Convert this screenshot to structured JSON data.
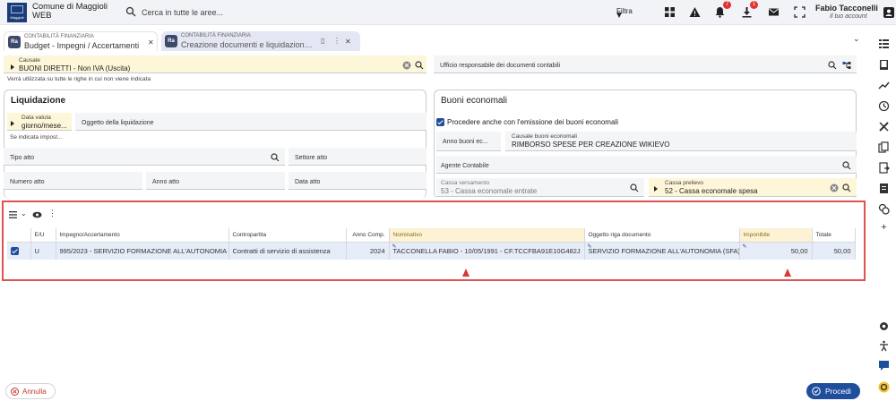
{
  "header": {
    "logo_text": "Maggioli",
    "app_title": "Comune di Maggioli WEB",
    "search_placeholder": "Cerca in tutte le aree...",
    "filter_label": "Filtra",
    "notifications_badge": "7",
    "downloads_badge": "1",
    "user_name": "Fabio Tacconelli",
    "user_subtitle": "Il tuo account"
  },
  "tabs": [
    {
      "icon": "Ra",
      "category": "CONTABILITÀ FINANZIARIA",
      "title": "Budget - Impegni / Accertamenti"
    },
    {
      "icon": "Ra",
      "category": "CONTABILITÀ FINANZIARIA",
      "title": "Creazione documenti e liquidazione fatture"
    }
  ],
  "form": {
    "causale": {
      "label": "Causale",
      "value": "BUONI DIRETTI - Non IVA (Uscita)"
    },
    "causale_hint": "Verrà utilizzata su tutte le righe in cui non viene indicata",
    "ufficio": {
      "label": "Ufficio responsabile dei documenti contabili"
    },
    "liquidazione": {
      "title": "Liquidazione",
      "data_valuta_label": "Data valuta",
      "data_valuta_value": "giorno/mese...",
      "oggetto_label": "Oggetto della liquidazione",
      "hint": "Se indicata impost...",
      "tipo_atto": "Tipo atto",
      "settore_atto": "Settore atto",
      "numero_atto": "Numero atto",
      "anno_atto": "Anno atto",
      "data_atto": "Data atto"
    },
    "buoni": {
      "title": "Buoni economali",
      "checkbox_label": "Procedere anche con l'emissione dei buoni economali",
      "anno_buoni": "Anno buoni ec...",
      "causale_buoni_label": "Causale buoni economali",
      "causale_buoni_value": "RIMBORSO SPESE PER CREAZIONE WIKIEVO",
      "agente": "Agente Contabile",
      "cassa_versamento_label": "Cassa versamento",
      "cassa_versamento_value": "53 - Cassa economale entrate",
      "cassa_prelievo_label": "Cassa prelievo",
      "cassa_prelievo_value": "52 - Cassa economale spesa"
    }
  },
  "table": {
    "columns": [
      "",
      "E/U",
      "Impegno/Accertamento",
      "Contropartita",
      "Anno Comp.",
      "Nominativo",
      "Oggetto riga documento",
      "Imponibile",
      "Totale"
    ],
    "rows": [
      {
        "eu": "U",
        "impegno": "995/2023 - SERVIZIO FORMAZIONE ALL'AUTONOMIA",
        "contropartita": "Contratti di servizio di assistenza",
        "anno": "2024",
        "nominativo": "TACCONELLA FABIO - 10/05/1991 - CF.TCCFBA91E10G482J",
        "oggetto": "SERVIZIO FORMAZIONE ALL'AUTONOMIA (SFA)",
        "imponibile": "50,00",
        "totale": "50,00"
      }
    ]
  },
  "footer": {
    "cancel_label": "Annulla",
    "proceed_label": "Procedi"
  },
  "colors": {
    "primary": "#1f4f9c",
    "highlight_field": "#fdf6d8",
    "annotation_red": "#e05250"
  }
}
